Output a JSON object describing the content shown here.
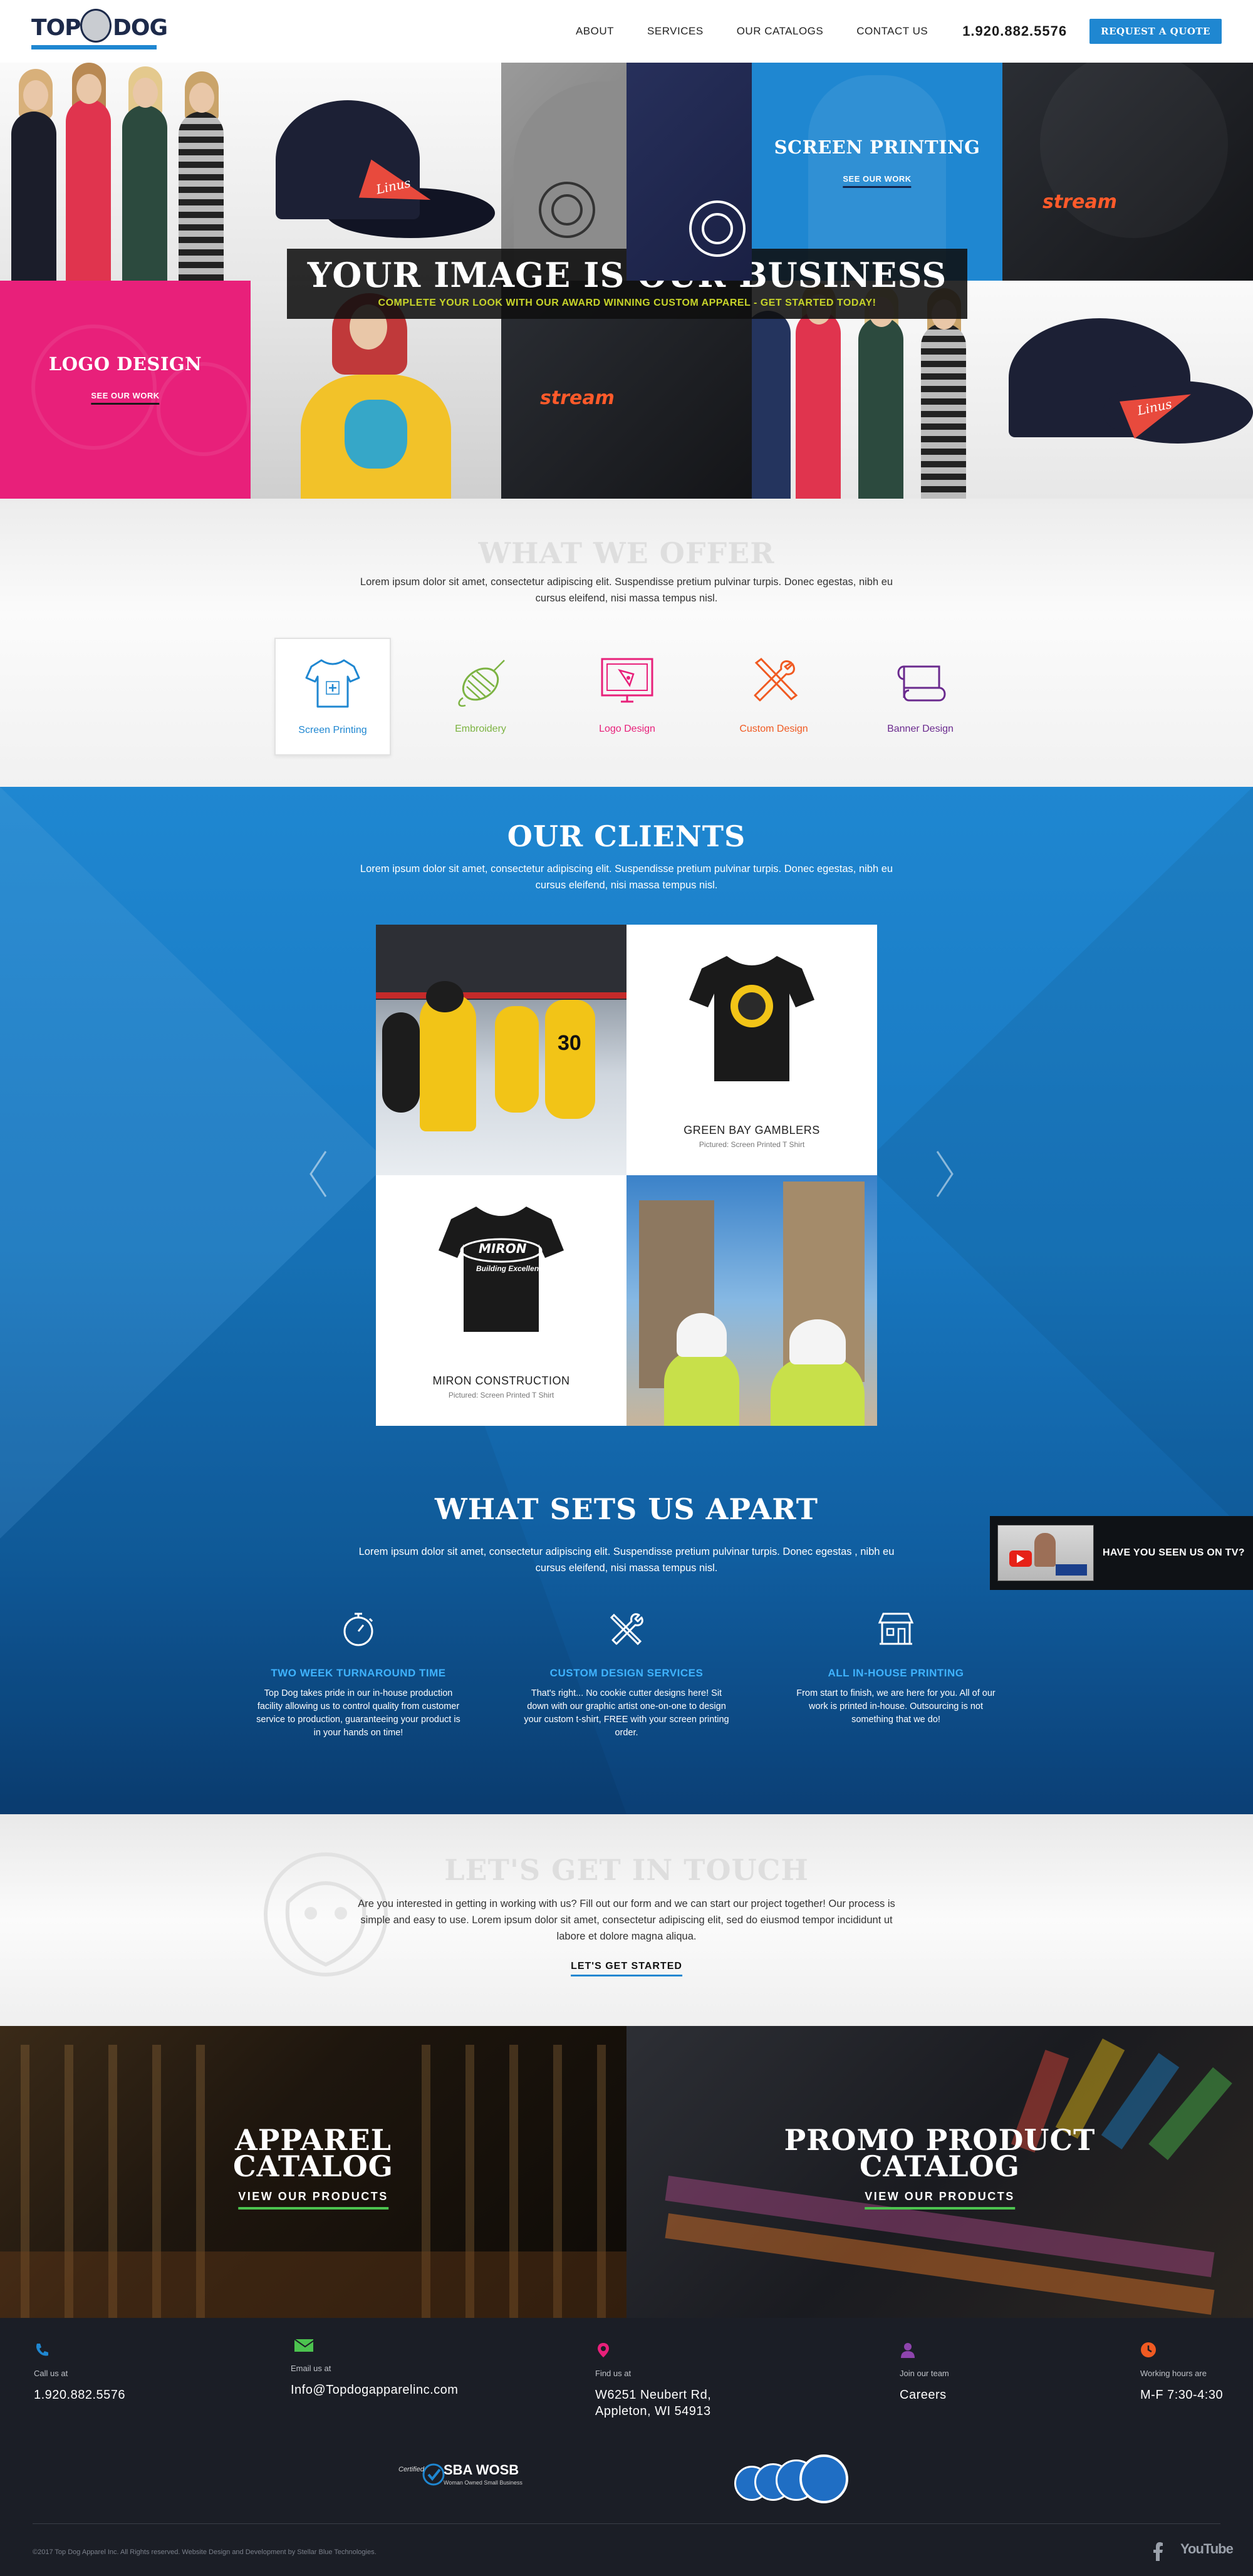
{
  "header": {
    "logo_text_left": "TOP",
    "logo_text_right": "DOG",
    "nav": [
      "ABOUT",
      "SERVICES",
      "OUR CATALOGS",
      "CONTACT US"
    ],
    "phone": "1.920.882.5576",
    "quote_button": "REQUEST A QUOTE"
  },
  "hero": {
    "title": "YOUR IMAGE IS OUR BUSINESS",
    "subtitle": "COMPLETE YOUR LOOK WITH OUR AWARD WINNING CUSTOM APPAREL - GET STARTED TODAY!",
    "tiles": {
      "screen_printing_title": "SCREEN PRINTING",
      "screen_printing_link": "SEE OUR WORK",
      "logo_design_title": "LOGO DESIGN",
      "logo_design_link": "SEE OUR WORK",
      "pennant_text": "Linus",
      "stream_text": "stream"
    }
  },
  "offer": {
    "title": "WHAT WE OFFER",
    "text": "Lorem ipsum dolor sit amet, consectetur adipiscing elit. Suspendisse pretium pulvinar turpis. Donec egestas, nibh eu cursus eleifend, nisi massa tempus nisl.",
    "items": [
      {
        "label": "Screen Printing",
        "color": "#1f87d1"
      },
      {
        "label": "Embroidery",
        "color": "#7cb342"
      },
      {
        "label": "Logo Design",
        "color": "#e8207a"
      },
      {
        "label": "Custom Design",
        "color": "#f05a22"
      },
      {
        "label": "Banner Design",
        "color": "#6a2a8e"
      }
    ]
  },
  "clients": {
    "title": "OUR CLIENTS",
    "text": "Lorem ipsum dolor sit amet, consectetur adipiscing elit. Suspendisse pretium pulvinar turpis. Donec egestas, nibh eu cursus eleifend, nisi massa tempus nisl.",
    "cards": [
      {
        "name": "GREEN BAY GAMBLERS",
        "sub": "Pictured: Screen Printed T Shirt"
      },
      {
        "name": "MIRON CONSTRUCTION",
        "sub": "Pictured: Screen Printed T Shirt"
      }
    ],
    "miron_logo_text": "MIRON",
    "miron_tag": "Building Excellence"
  },
  "apart": {
    "title": "WHAT SETS US APART",
    "text": "Lorem ipsum dolor sit amet, consectetur adipiscing elit. Suspendisse pretium pulvinar turpis. Donec egestas , nibh eu cursus eleifend, nisi massa tempus nisl.",
    "items": [
      {
        "title": "TWO WEEK TURNAROUND TIME",
        "text": "Top Dog takes pride in our in-house production facility allowing us to control quality from customer service to production, guaranteeing your product is in your hands on time!"
      },
      {
        "title": "CUSTOM DESIGN SERVICES",
        "text": "That's right... No cookie cutter designs here! Sit down with our graphic artist one-on-one to design your custom t-shirt, FREE with your screen printing order."
      },
      {
        "title": "ALL IN-HOUSE PRINTING",
        "text": "From start to finish, we are here for you. All of our work is printed in-house. Outsourcing is not something that we do!"
      }
    ],
    "tv_label": "HAVE YOU SEEN US ON TV?"
  },
  "touch": {
    "title": "LET'S GET IN TOUCH",
    "text": "Are you interested in getting in working with us? Fill out our form and we can start our project together! Our process is simple and easy to use. Lorem ipsum dolor sit amet, consectetur adipiscing elit, sed do eiusmod tempor incididunt ut labore et dolore magna aliqua.",
    "link": "LET'S GET STARTED"
  },
  "catalogs": [
    {
      "title_line1": "APPAREL",
      "title_line2": "CATALOG",
      "link": "VIEW OUR PRODUCTS"
    },
    {
      "title_line1": "PROMO PRODUCT",
      "title_line2": "CATALOG",
      "link": "VIEW OUR PRODUCTS"
    }
  ],
  "footer": {
    "cols": [
      {
        "label": "Call us at",
        "value": "1.920.882.5576",
        "color": "#1f87d1"
      },
      {
        "label": "Email us at",
        "value": "Info@Topdogapparelinc.com",
        "color": "#4cc34f"
      },
      {
        "label": "Find us at",
        "value": "W6251 Neubert Rd, Appleton, WI 54913",
        "color": "#e8207a"
      },
      {
        "label": "Join our team",
        "value": "Careers",
        "color": "#8e44ad"
      },
      {
        "label": "Working hours are",
        "value": "M-F 7:30-4:30",
        "color": "#f05a22"
      }
    ],
    "sba_certified": "Certified",
    "sba_name": "SBA WOSB",
    "sba_sub": "Woman Owned Small Business",
    "copyright": "©2017 Top Dog Apparel Inc. All Rights reserved. Website Design and Development by Stellar Blue Technologies.",
    "youtube": "YouTube"
  }
}
